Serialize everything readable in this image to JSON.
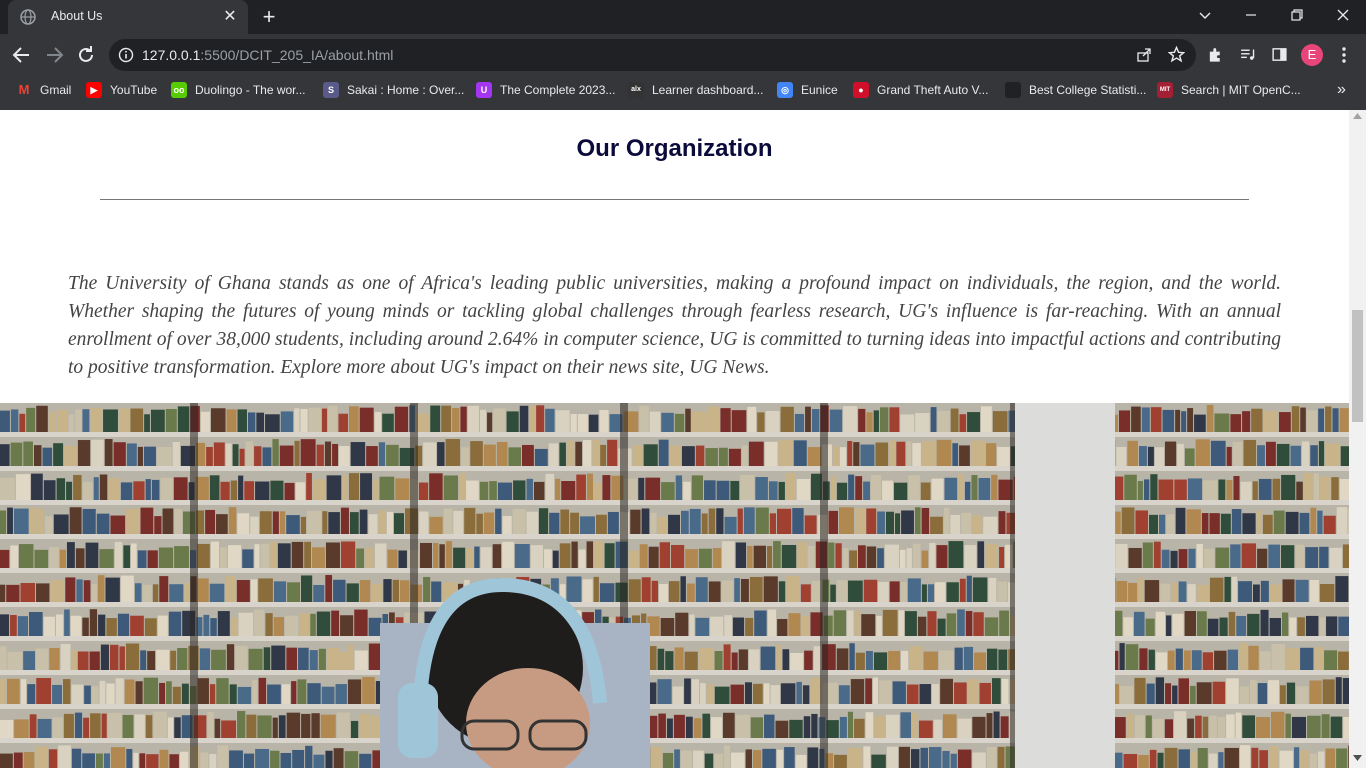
{
  "browser": {
    "tab_title": "About Us",
    "url_host": "127.0.0.1",
    "url_path": ":5500/DCIT_205_IA/about.html",
    "profile_initial": "E",
    "accent_color": "#e8457a",
    "bookmarks": [
      {
        "label": "Gmail",
        "icon": "gmail-icon",
        "color": "#ffffff",
        "glyph": "M"
      },
      {
        "label": "YouTube",
        "icon": "youtube-icon",
        "color": "#ff0000",
        "glyph": "▶"
      },
      {
        "label": "Duolingo - The wor...",
        "icon": "duolingo-icon",
        "color": "#58cc02",
        "glyph": "oo"
      },
      {
        "label": "Sakai : Home : Over...",
        "icon": "sakai-icon",
        "color": "#5a5a8a",
        "glyph": "S"
      },
      {
        "label": "The Complete 2023...",
        "icon": "udemy-icon",
        "color": "#a435f0",
        "glyph": "U"
      },
      {
        "label": "Learner dashboard...",
        "icon": "alx-icon",
        "color": "#333333",
        "glyph": "alx"
      },
      {
        "label": "Eunice",
        "icon": "swirl-icon",
        "color": "#4285f4",
        "glyph": "◎"
      },
      {
        "label": "Grand Theft Auto V...",
        "icon": "gta-icon",
        "color": "#d0102b",
        "glyph": "●"
      },
      {
        "label": "Best College Statisti...",
        "icon": "globe-icon",
        "color": "#202124",
        "glyph": ""
      },
      {
        "label": "Search | MIT OpenC...",
        "icon": "mit-icon",
        "color": "#a31f34",
        "glyph": "MIT"
      }
    ],
    "more_bookmarks": "»"
  },
  "page": {
    "heading": "Our Organization",
    "paragraph": "The University of Ghana stands as one of Africa's leading public universities, making a profound impact on individuals, the region, and the world. Whether shaping the futures of young minds or tackling global challenges through fearless research, UG's influence is far-reaching. With an annual enrollment of over 38,000 students, including around 2.64% in computer science, UG is committed to turning ideas into impactful actions and contributing to positive transformation. Explore more about UG's impact on their news site, UG News."
  }
}
